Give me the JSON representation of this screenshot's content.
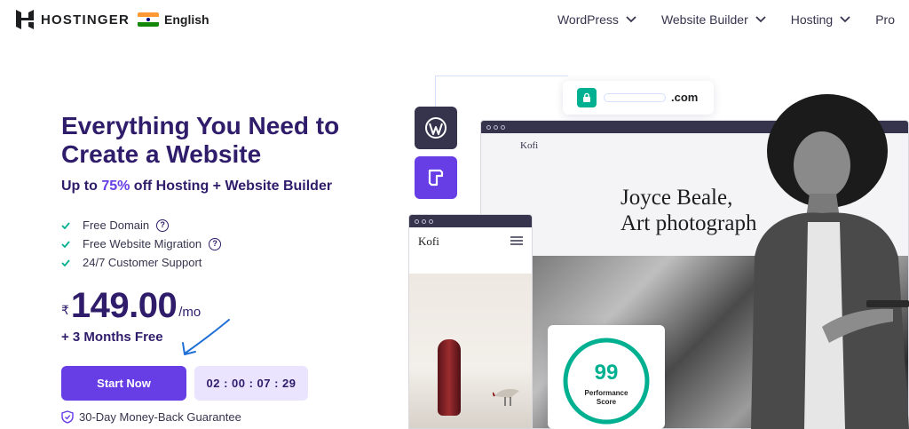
{
  "header": {
    "brand": "HOSTINGER",
    "language": "English",
    "nav": [
      {
        "label": "WordPress",
        "has_dropdown": true
      },
      {
        "label": "Website Builder",
        "has_dropdown": true
      },
      {
        "label": "Hosting",
        "has_dropdown": true
      },
      {
        "label": "Pro",
        "has_dropdown": false
      }
    ]
  },
  "hero": {
    "title": "Everything You Need to Create a Website",
    "subtitle_prefix": "Up to ",
    "subtitle_accent": "75%",
    "subtitle_suffix": " off Hosting + Website Builder",
    "features": [
      {
        "label": "Free Domain",
        "help": true
      },
      {
        "label": "Free Website Migration",
        "help": true
      },
      {
        "label": "24/7 Customer Support",
        "help": false
      }
    ],
    "price_currency": "₹",
    "price_amount": "149.00",
    "price_period": "/mo",
    "bonus": "+ 3 Months Free",
    "cta_label": "Start Now",
    "countdown": "02 : 00 : 07 : 29",
    "guarantee": "30-Day Money-Back Guarantee"
  },
  "illustration": {
    "domain_tld": ".com",
    "big_site_brand": "Kofi",
    "big_site_headline_line1": "Joyce Beale,",
    "big_site_headline_line2": "Art photograph",
    "small_site_brand": "Kofi",
    "performance_score": "99",
    "performance_label": "Performance Score"
  },
  "colors": {
    "primary": "#673de6",
    "heading": "#2f1c6a",
    "success": "#00b090",
    "timer_bg": "#ebe4ff"
  }
}
